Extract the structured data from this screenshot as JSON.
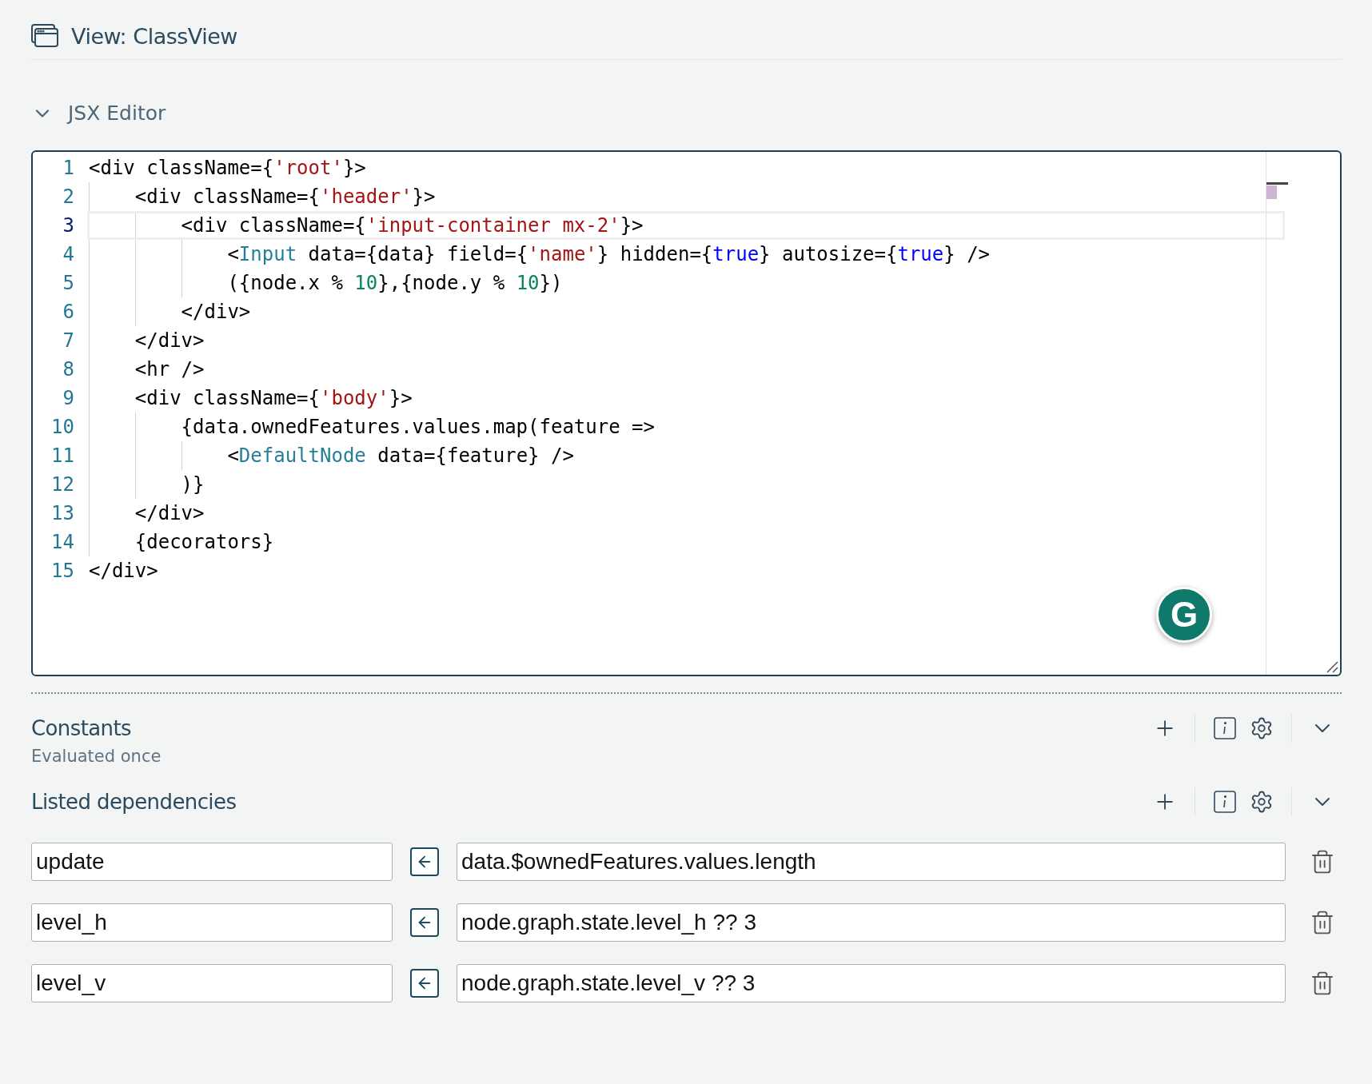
{
  "view": {
    "title": "View: ClassView"
  },
  "editor_section": {
    "title": "JSX Editor",
    "expanded": true
  },
  "editor": {
    "lines": [
      {
        "number": "1",
        "current": false,
        "tokens": [
          {
            "kind": "plain",
            "text": "<div className={"
          },
          {
            "kind": "string",
            "text": "'root'"
          },
          {
            "kind": "plain",
            "text": "}>"
          }
        ]
      },
      {
        "number": "2",
        "current": false,
        "tokens": [
          {
            "kind": "plain",
            "text": "    <div className={"
          },
          {
            "kind": "string",
            "text": "'header'"
          },
          {
            "kind": "plain",
            "text": "}>"
          }
        ]
      },
      {
        "number": "3",
        "current": true,
        "tokens": [
          {
            "kind": "plain",
            "text": "        <div className={"
          },
          {
            "kind": "string",
            "text": "'input-container mx-2'"
          },
          {
            "kind": "plain",
            "text": "}>"
          }
        ]
      },
      {
        "number": "4",
        "current": false,
        "tokens": [
          {
            "kind": "plain",
            "text": "            <"
          },
          {
            "kind": "tag",
            "text": "Input"
          },
          {
            "kind": "plain",
            "text": " data={data} field={"
          },
          {
            "kind": "string",
            "text": "'name'"
          },
          {
            "kind": "plain",
            "text": "} hidden={"
          },
          {
            "kind": "keyword",
            "text": "true"
          },
          {
            "kind": "plain",
            "text": "} autosize={"
          },
          {
            "kind": "keyword",
            "text": "true"
          },
          {
            "kind": "plain",
            "text": "} />"
          }
        ]
      },
      {
        "number": "5",
        "current": false,
        "tokens": [
          {
            "kind": "plain",
            "text": "            ({node.x % "
          },
          {
            "kind": "number",
            "text": "10"
          },
          {
            "kind": "plain",
            "text": "},{node.y % "
          },
          {
            "kind": "number",
            "text": "10"
          },
          {
            "kind": "plain",
            "text": "})"
          }
        ]
      },
      {
        "number": "6",
        "current": false,
        "tokens": [
          {
            "kind": "plain",
            "text": "        </div>"
          }
        ]
      },
      {
        "number": "7",
        "current": false,
        "tokens": [
          {
            "kind": "plain",
            "text": "    </div>"
          }
        ]
      },
      {
        "number": "8",
        "current": false,
        "tokens": [
          {
            "kind": "plain",
            "text": "    <hr />"
          }
        ]
      },
      {
        "number": "9",
        "current": false,
        "tokens": [
          {
            "kind": "plain",
            "text": "    <div className={"
          },
          {
            "kind": "string",
            "text": "'body'"
          },
          {
            "kind": "plain",
            "text": "}>"
          }
        ]
      },
      {
        "number": "10",
        "current": false,
        "tokens": [
          {
            "kind": "plain",
            "text": "        {data.ownedFeatures.values.map(feature =>"
          }
        ]
      },
      {
        "number": "11",
        "current": false,
        "tokens": [
          {
            "kind": "plain",
            "text": "            <"
          },
          {
            "kind": "tag",
            "text": "DefaultNode"
          },
          {
            "kind": "plain",
            "text": " data={feature} />"
          }
        ]
      },
      {
        "number": "12",
        "current": false,
        "tokens": [
          {
            "kind": "plain",
            "text": "        )}"
          }
        ]
      },
      {
        "number": "13",
        "current": false,
        "tokens": [
          {
            "kind": "plain",
            "text": "    </div>"
          }
        ]
      },
      {
        "number": "14",
        "current": false,
        "tokens": [
          {
            "kind": "plain",
            "text": "    {decorators}"
          }
        ]
      },
      {
        "number": "15",
        "current": false,
        "tokens": [
          {
            "kind": "plain",
            "text": "</div>"
          }
        ]
      }
    ],
    "assistant_badge": {
      "label": "G"
    }
  },
  "constants": {
    "title": "Constants",
    "subtitle": "Evaluated once"
  },
  "dependencies": {
    "title": "Listed dependencies",
    "rows": [
      {
        "name": "update",
        "expression": "data.$ownedFeatures.values.length"
      },
      {
        "name": "level_h",
        "expression": "node.graph.state.level_h ?? 3"
      },
      {
        "name": "level_v",
        "expression": "node.graph.state.level_v ?? 3"
      }
    ]
  }
}
